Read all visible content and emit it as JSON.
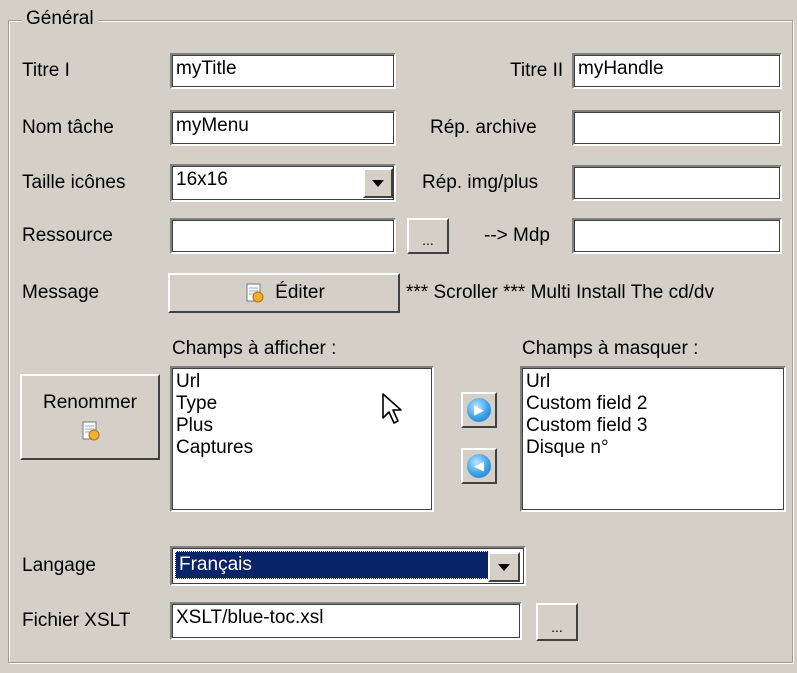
{
  "group": {
    "title": "Général"
  },
  "fields": {
    "titre1": {
      "label": "Titre I",
      "value": "myTitle"
    },
    "titre2": {
      "label": "Titre II",
      "value": "myHandle"
    },
    "nom_tache": {
      "label": "Nom tâche",
      "value": "myMenu"
    },
    "rep_archive": {
      "label": "Rép. archive",
      "value": ""
    },
    "taille_icones": {
      "label": "Taille icônes",
      "value": "16x16"
    },
    "rep_img": {
      "label": "Rép. img/plus",
      "value": ""
    },
    "ressource": {
      "label": "Ressource",
      "value": "",
      "browse": "..."
    },
    "mdp": {
      "label": "--> Mdp",
      "value": ""
    }
  },
  "message": {
    "label": "Message",
    "edit_button": "Éditer",
    "preview": "*** Scroller *** Multi Install  The cd/dv"
  },
  "lists": {
    "show_label": "Champs à afficher :",
    "show_items": [
      "Url",
      "Type",
      "Plus",
      "Captures"
    ],
    "hide_label": "Champs à masquer :",
    "hide_items": [
      "Url",
      "Custom field 2",
      "Custom field 3",
      "Disque n°"
    ],
    "rename_button": "Renommer"
  },
  "langage": {
    "label": "Langage",
    "value": "Français"
  },
  "xslt": {
    "label": "Fichier XSLT",
    "value": "XSLT/blue-toc.xsl",
    "browse": "..."
  },
  "colors": {
    "background": "#d4d0c8",
    "selection": "#0a246a",
    "selection_text": "#ffffff"
  }
}
